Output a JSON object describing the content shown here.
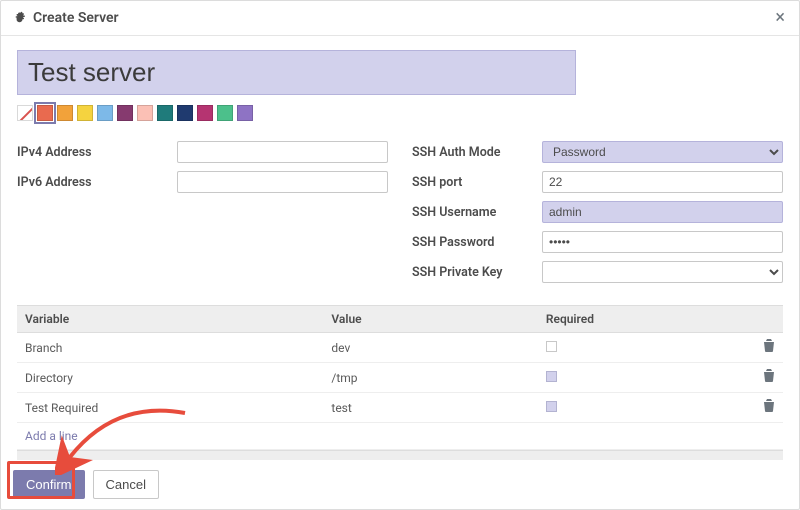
{
  "dialog": {
    "title": "Create Server",
    "close_glyph": "×"
  },
  "server_name": "Test server",
  "colors": {
    "swatches": [
      "#e96a4f",
      "#f2a23a",
      "#f5d33f",
      "#7db9e8",
      "#863a6f",
      "#fbc0b5",
      "#1f7b7b",
      "#1f3a6f",
      "#b53471",
      "#4cc08b",
      "#8e73c4"
    ]
  },
  "left_fields": {
    "ipv4_label": "IPv4 Address",
    "ipv4_value": "",
    "ipv6_label": "IPv6 Address",
    "ipv6_value": ""
  },
  "right_fields": {
    "auth_label": "SSH Auth Mode",
    "auth_value": "Password",
    "port_label": "SSH port",
    "port_value": "22",
    "user_label": "SSH Username",
    "user_value": "admin",
    "pass_label": "SSH Password",
    "pass_value": "•••••",
    "key_label": "SSH Private Key",
    "key_value": ""
  },
  "table": {
    "col_variable": "Variable",
    "col_value": "Value",
    "col_required": "Required",
    "rows": [
      {
        "variable": "Branch",
        "value": "dev",
        "required": false
      },
      {
        "variable": "Directory",
        "value": "/tmp",
        "required": true
      },
      {
        "variable": "Test Required",
        "value": "test",
        "required": true
      }
    ],
    "add_line": "Add a line"
  },
  "footer": {
    "confirm": "Confirm",
    "cancel": "Cancel"
  }
}
